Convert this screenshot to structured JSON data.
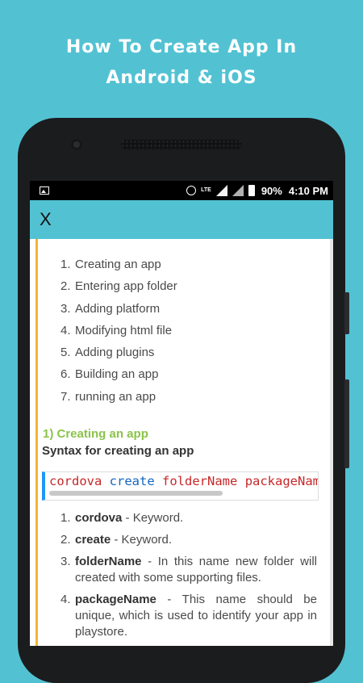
{
  "promo": {
    "title_line1": "How To Create App In",
    "title_line2": "Android & iOS"
  },
  "status_bar": {
    "network": "LTE",
    "battery": "90%",
    "time": "4:10 PM"
  },
  "app_bar": {
    "close_label": "X"
  },
  "toc": [
    {
      "num": "1.",
      "label": "Creating an app"
    },
    {
      "num": "2.",
      "label": "Entering app folder"
    },
    {
      "num": "3.",
      "label": "Adding platform"
    },
    {
      "num": "4.",
      "label": "Modifying html file"
    },
    {
      "num": "5.",
      "label": "Adding plugins"
    },
    {
      "num": "6.",
      "label": "Building an app"
    },
    {
      "num": "7.",
      "label": "running an app"
    }
  ],
  "section": {
    "heading": "1) Creating an app",
    "subheading": "Syntax for creating an app",
    "code": {
      "tok1": "cordova",
      "tok2": "create",
      "tok3": "folderName",
      "tok4": "packageName"
    },
    "definitions": [
      {
        "num": "1.",
        "term": "cordova",
        "desc": " - Keyword."
      },
      {
        "num": "2.",
        "term": "create",
        "desc": " - Keyword."
      },
      {
        "num": "3.",
        "term": "folderName",
        "desc": " - In this name new folder will created with some supporting files."
      },
      {
        "num": "4.",
        "term": "packageName",
        "desc": " - This name should be unique, which is used to identify your app in playstore."
      }
    ]
  },
  "colors": {
    "background": "#52c2d3",
    "accent_bar": "#f5b432",
    "heading_green": "#8bc34a",
    "code_border_blue": "#2196f3"
  }
}
